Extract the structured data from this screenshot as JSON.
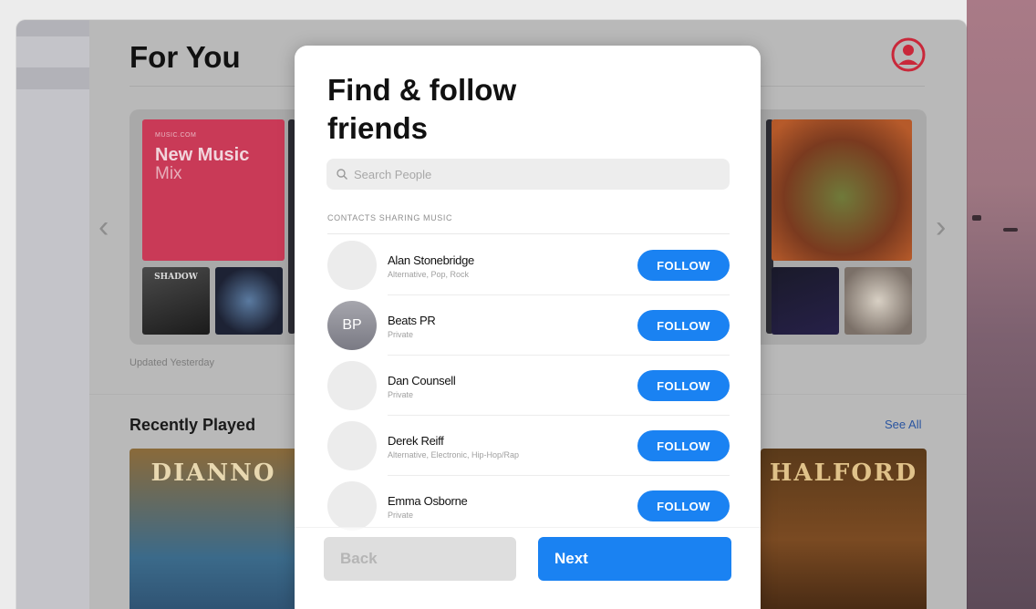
{
  "for_you": {
    "title": "For You",
    "new_music_tile": {
      "small": "MUSIC.COM",
      "title": "New Music",
      "subtitle": "Mix"
    },
    "album_small_1": "SHADOW",
    "updated": "Updated Yesterday"
  },
  "recently_played": {
    "title": "Recently Played",
    "see_all": "See All",
    "albums": [
      {
        "text": "DIANNO"
      },
      {
        "text": "HALFORD"
      }
    ]
  },
  "modal": {
    "title": "Find & follow friends",
    "search_placeholder": "Search People",
    "section_header": "CONTACTS SHARING MUSIC",
    "follow_label": "FOLLOW",
    "contacts": [
      {
        "name": "Alan Stonebridge",
        "sub": "Alternative, Pop, Rock",
        "initials": ""
      },
      {
        "name": "Beats PR",
        "sub": "Private",
        "initials": "BP"
      },
      {
        "name": "Dan Counsell",
        "sub": "Private",
        "initials": ""
      },
      {
        "name": "Derek Reiff",
        "sub": "Alternative, Electronic, Hip-Hop/Rap",
        "initials": ""
      },
      {
        "name": "Emma Osborne",
        "sub": "Private",
        "initials": ""
      }
    ],
    "back_label": "Back",
    "next_label": "Next"
  },
  "colors": {
    "accent": "#1a82f2",
    "new_music_tile": "#c93a57"
  }
}
